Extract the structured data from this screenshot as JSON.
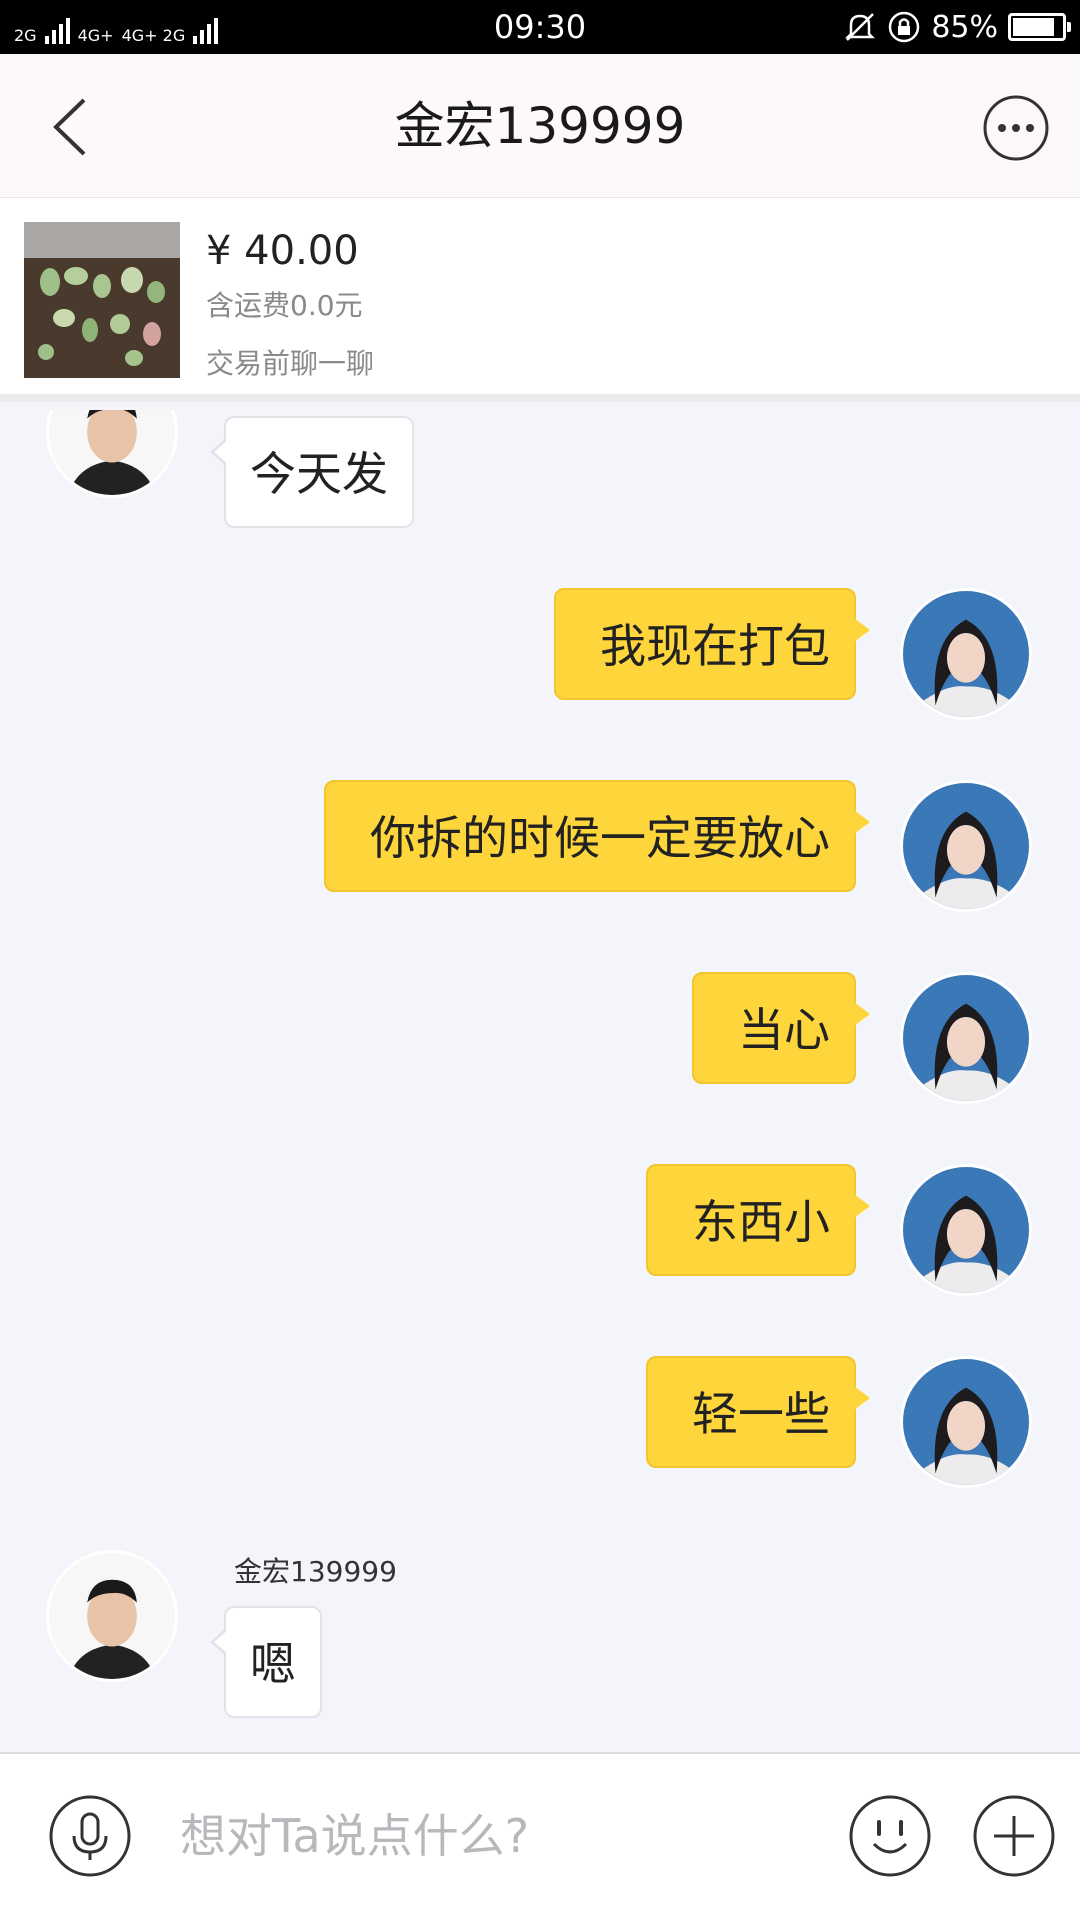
{
  "status_bar": {
    "net1": "2G",
    "net2": "4G+",
    "net3": "4G+ 2G",
    "time": "09:30",
    "battery_pct": "85%",
    "battery_level": 0.85,
    "icons": [
      "signal-icon",
      "mute-icon",
      "rotation-lock-icon",
      "battery-icon"
    ]
  },
  "header": {
    "title": "金宏139999",
    "back_icon": "back-chevron-icon",
    "more_icon": "more-dots-icon"
  },
  "product": {
    "price": "¥ 40.00",
    "shipping": "含运费0.0元",
    "note": "交易前聊一聊"
  },
  "messages": [
    {
      "side": "in",
      "text": "今天发"
    },
    {
      "side": "out",
      "text": "我现在打包"
    },
    {
      "side": "out",
      "text": "你拆的时候一定要放心"
    },
    {
      "side": "out",
      "text": "当心"
    },
    {
      "side": "out",
      "text": "东西小"
    },
    {
      "side": "out",
      "text": "轻一些"
    },
    {
      "side": "in",
      "sender": "金宏139999",
      "text": "嗯"
    }
  ],
  "input": {
    "placeholder": "想对Ta说点什么?",
    "icons": [
      "microphone-icon",
      "emoji-icon",
      "plus-icon"
    ]
  },
  "colors": {
    "outgoing_bubble": "#fed53b",
    "incoming_bubble": "#ffffff",
    "chat_background": "#f4f5fa",
    "header_background": "#fdf8fc"
  }
}
